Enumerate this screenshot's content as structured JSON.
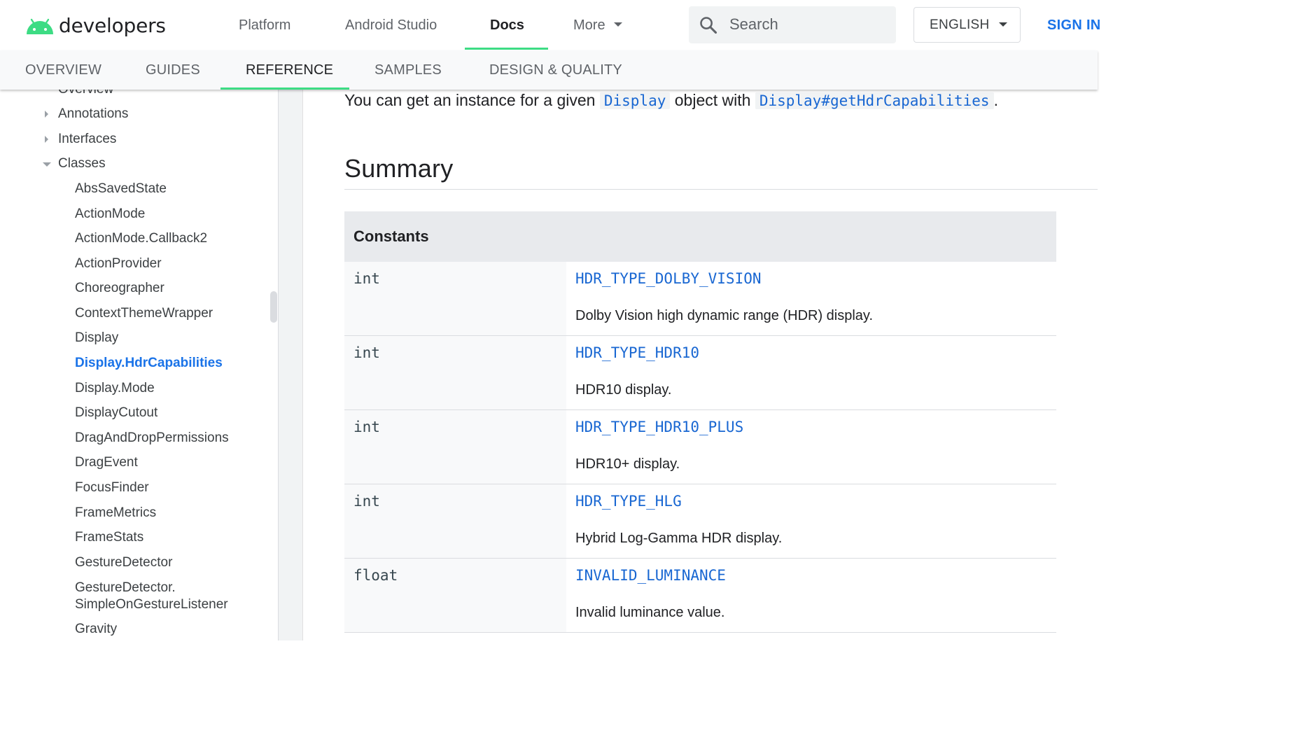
{
  "header": {
    "logo_text": "developers",
    "nav": [
      "Platform",
      "Android Studio",
      "Docs",
      "More"
    ],
    "active_nav": "Docs",
    "search_placeholder": "Search",
    "language": "ENGLISH",
    "sign_in": "SIGN IN",
    "accent_color": "#3ddc84",
    "link_color": "#1a73e8"
  },
  "tabs": [
    "OVERVIEW",
    "GUIDES",
    "REFERENCE",
    "SAMPLES",
    "DESIGN & QUALITY"
  ],
  "active_tab": "REFERENCE",
  "sidebar": {
    "partial_top": "Overview",
    "sections": [
      {
        "label": "Annotations",
        "state": "collapsed"
      },
      {
        "label": "Interfaces",
        "state": "collapsed"
      },
      {
        "label": "Classes",
        "state": "expanded"
      }
    ],
    "classes": [
      "AbsSavedState",
      "ActionMode",
      "ActionMode.Callback2",
      "ActionProvider",
      "Choreographer",
      "ContextThemeWrapper",
      "Display",
      "Display.HdrCapabilities",
      "Display.Mode",
      "DisplayCutout",
      "DragAndDropPermissions",
      "DragEvent",
      "FocusFinder",
      "FrameMetrics",
      "FrameStats",
      "GestureDetector",
      "GestureDetector.\nSimpleOnGestureListener",
      "Gravity"
    ],
    "selected": "Display.HdrCapabilities"
  },
  "content": {
    "intro_before": "You can get an instance for a given ",
    "intro_link1": "Display",
    "intro_middle": " object with ",
    "intro_link2": "Display#getHdrCapabilities",
    "intro_after": ".",
    "summary_title": "Summary",
    "constants_header": "Constants",
    "constants": [
      {
        "type": "int",
        "name": "HDR_TYPE_DOLBY_VISION",
        "desc": "Dolby Vision high dynamic range (HDR) display."
      },
      {
        "type": "int",
        "name": "HDR_TYPE_HDR10",
        "desc": "HDR10 display."
      },
      {
        "type": "int",
        "name": "HDR_TYPE_HDR10_PLUS",
        "desc": "HDR10+ display."
      },
      {
        "type": "int",
        "name": "HDR_TYPE_HLG",
        "desc": "Hybrid Log-Gamma HDR display."
      },
      {
        "type": "float",
        "name": "INVALID_LUMINANCE",
        "desc": "Invalid luminance value."
      }
    ]
  }
}
